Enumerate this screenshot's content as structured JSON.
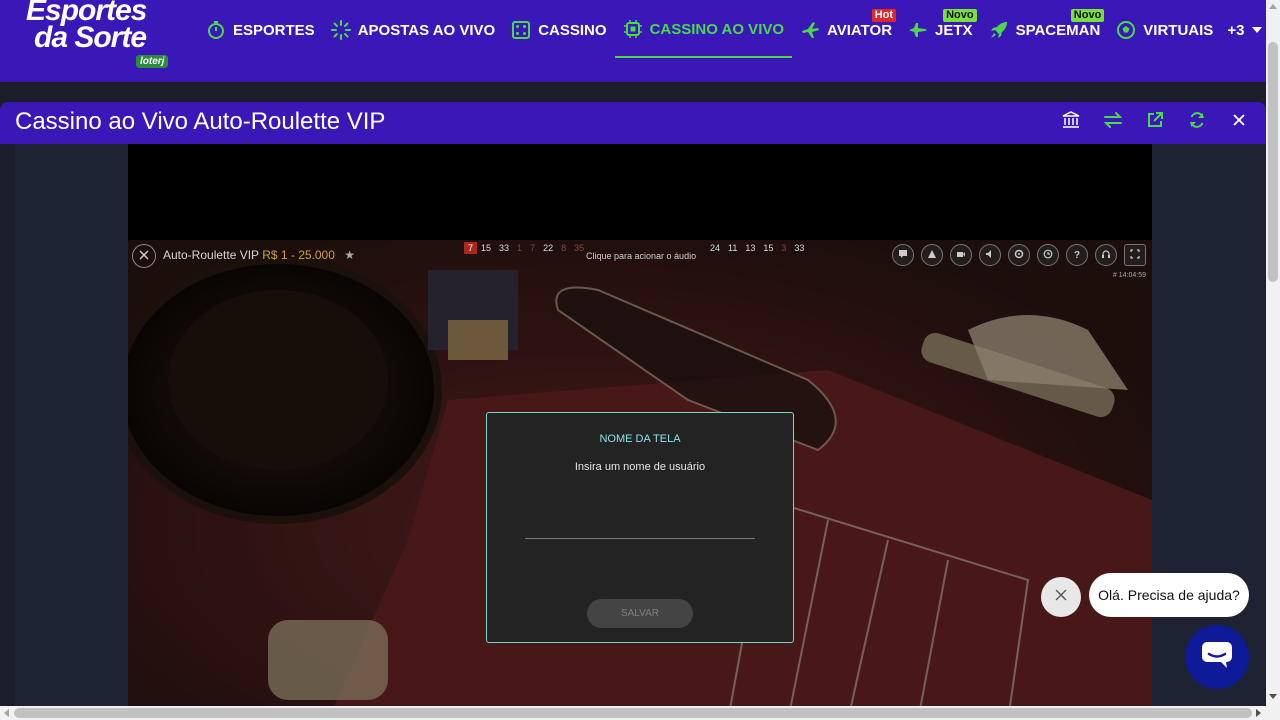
{
  "logo": {
    "line1": "Esportes",
    "line2": "da Sorte",
    "badge": "loterj"
  },
  "nav": {
    "items": [
      {
        "label": "ESPORTES",
        "icon": "stopwatch-icon"
      },
      {
        "label": "APOSTAS AO VIVO",
        "icon": "live-burst-icon"
      },
      {
        "label": "CASSINO",
        "icon": "dice-icon"
      },
      {
        "label": "CASSINO AO VIVO",
        "icon": "chip-icon",
        "active": true
      },
      {
        "label": "AVIATOR",
        "icon": "plane-icon",
        "tag": "Hot"
      },
      {
        "label": "JETX",
        "icon": "jet-icon",
        "tag": "Novo"
      },
      {
        "label": "SPACEMAN",
        "icon": "rocket-icon",
        "tag": "Novo"
      },
      {
        "label": "VIRTUAIS",
        "icon": "soccer-ball-icon"
      }
    ],
    "more_label": "+3"
  },
  "game": {
    "title": "Cassino ao Vivo Auto-Roulette VIP",
    "tools": [
      "bank-icon",
      "swap-icon",
      "external-link-icon",
      "refresh-icon",
      "close-icon"
    ]
  },
  "player": {
    "game_name": "Auto-Roulette VIP",
    "limits": "R$ 1 - 25.000",
    "results_left": [
      "7",
      "15",
      "33",
      "1",
      "7",
      "22",
      "8",
      "35"
    ],
    "results_right": [
      "24",
      "11",
      "13",
      "15",
      "3",
      "33"
    ],
    "audio_hint": "Clique para acionar o áudio",
    "clock": "# 14:04:59"
  },
  "modal": {
    "title": "NOME DA TELA",
    "text": "Insira um nome de usuário",
    "input_value": "",
    "button": "SALVAR"
  },
  "chat": {
    "bubble": "Olá. Precisa de ajuda?"
  },
  "colors": {
    "brand": "#3a18b8",
    "accent": "#4bd84b",
    "hot": "#e2272a",
    "new": "#78e03a"
  }
}
